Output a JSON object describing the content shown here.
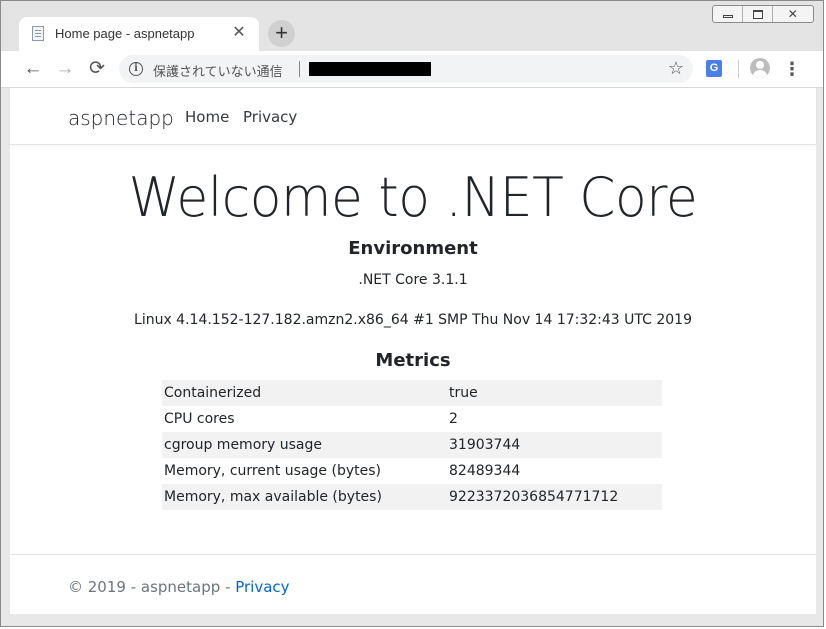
{
  "browser": {
    "tab": {
      "title": "Home page - aspnetapp",
      "close_glyph": "✕"
    },
    "new_tab_glyph": "+",
    "window_controls": {
      "close_glyph": "✕"
    },
    "toolbar": {
      "back_glyph": "←",
      "forward_glyph": "→",
      "reload_glyph": "⟳",
      "security_text": "保護されていない通信",
      "star_glyph": "☆",
      "translate_glyph": "G",
      "menu_glyph": "⋮"
    }
  },
  "page": {
    "navbar": {
      "brand": "aspnetapp",
      "links": [
        "Home",
        "Privacy"
      ]
    },
    "heading": "Welcome to .NET Core",
    "environment": {
      "heading": "Environment",
      "version": ".NET Core 3.1.1",
      "os": "Linux 4.14.152-127.182.amzn2.x86_64 #1 SMP Thu Nov 14 17:32:43 UTC 2019"
    },
    "metrics": {
      "heading": "Metrics",
      "rows": [
        {
          "label": "Containerized",
          "value": "true"
        },
        {
          "label": "CPU cores",
          "value": "2"
        },
        {
          "label": "cgroup memory usage",
          "value": "31903744"
        },
        {
          "label": "Memory, current usage (bytes)",
          "value": "82489344"
        },
        {
          "label": "Memory, max available (bytes)",
          "value": "9223372036854771712"
        }
      ]
    },
    "footer": {
      "prefix": "© 2019 - aspnetapp - ",
      "link": "Privacy"
    }
  },
  "colors": {
    "link": "#0366d6",
    "text": "#212529",
    "muted": "#6c757d",
    "row_stripe": "#f2f2f2"
  }
}
